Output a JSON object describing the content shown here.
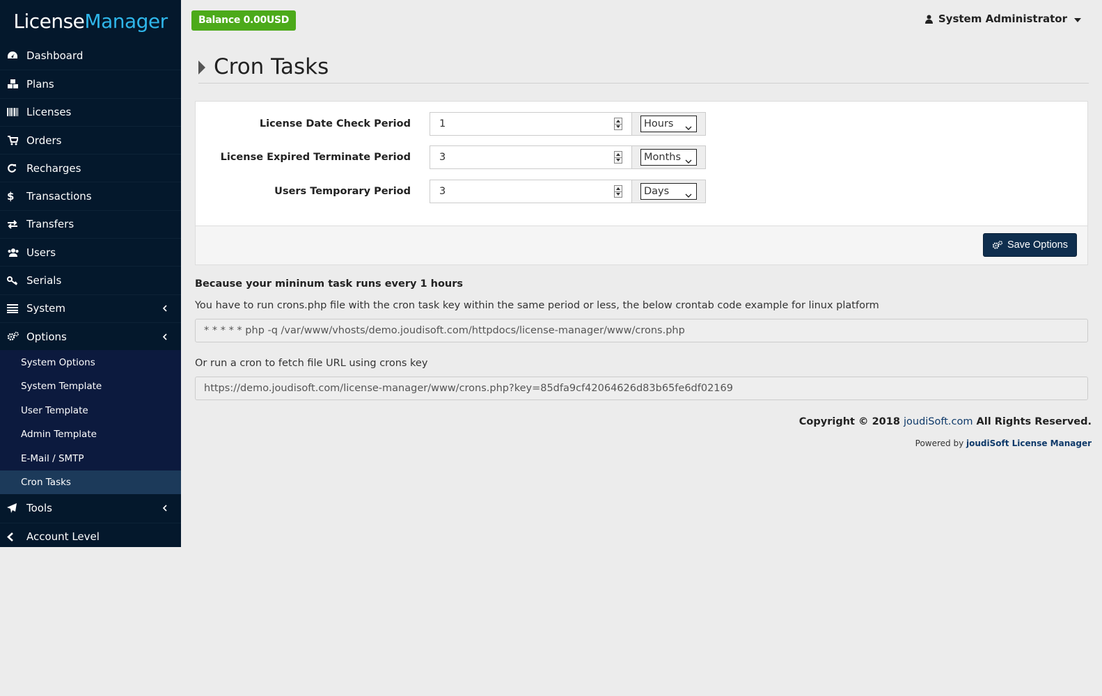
{
  "brand": {
    "part1": "License",
    "part2": "Manager"
  },
  "topbar": {
    "balance": "Balance 0.00USD",
    "user_name": "System Administrator"
  },
  "sidebar": {
    "items": [
      {
        "label": "Dashboard",
        "icon": "dashboard-icon"
      },
      {
        "label": "Plans",
        "icon": "cubes-icon"
      },
      {
        "label": "Licenses",
        "icon": "barcode-icon"
      },
      {
        "label": "Orders",
        "icon": "cart-icon"
      },
      {
        "label": "Recharges",
        "icon": "refresh-icon"
      },
      {
        "label": "Transactions",
        "icon": "dollar-icon"
      },
      {
        "label": "Transfers",
        "icon": "exchange-icon"
      },
      {
        "label": "Users",
        "icon": "users-icon"
      },
      {
        "label": "Serials",
        "icon": "key-icon"
      },
      {
        "label": "System",
        "icon": "list-icon"
      },
      {
        "label": "Options",
        "icon": "gears-icon"
      }
    ],
    "options_submenu": [
      {
        "label": "System Options"
      },
      {
        "label": "System Template"
      },
      {
        "label": "User Template"
      },
      {
        "label": "Admin Template"
      },
      {
        "label": "E-Mail / SMTP"
      },
      {
        "label": "Cron Tasks",
        "active": true
      }
    ],
    "bottom_items": [
      {
        "label": "Tools",
        "icon": "send-icon"
      },
      {
        "label": "Account Level",
        "icon": "chevron-left-icon"
      }
    ]
  },
  "page": {
    "title": "Cron Tasks"
  },
  "form": {
    "rows": [
      {
        "label": "License Date Check Period",
        "value": "1",
        "unit": "Hours"
      },
      {
        "label": "License Expired Terminate Period",
        "value": "3",
        "unit": "Months"
      },
      {
        "label": "Users Temporary Period",
        "value": "3",
        "unit": "Days"
      }
    ],
    "save_label": "Save Options"
  },
  "info": {
    "heading": "Because your mininum task runs every 1 hours",
    "text": "You have to run crons.php file with the cron task key within the same period or less, the below crontab code example for linux platform",
    "crontab": "* * * * * php -q /var/www/vhosts/demo.joudisoft.com/httpdocs/license-manager/www/crons.php",
    "text2": "Or run a cron to fetch file URL using crons key",
    "url": "https://demo.joudisoft.com/license-manager/www/crons.php?key=85dfa9cf42064626d83b65fe6df02169"
  },
  "footer": {
    "copyright_prefix": "Copyright © 2018 ",
    "copyright_link": "joudiSoft.com",
    "copyright_suffix": " All Rights Reserved.",
    "powered_prefix": "Powered by ",
    "powered_link": "joudiSoft License Manager"
  },
  "colors": {
    "sidebar_bg": "#04182c",
    "submenu_bg": "#0c1a3e",
    "active_bg": "#1c3a5a",
    "brand_accent": "#2fb6ea",
    "balance_bg": "#4caa1a",
    "button_bg": "#0f2e4e"
  }
}
